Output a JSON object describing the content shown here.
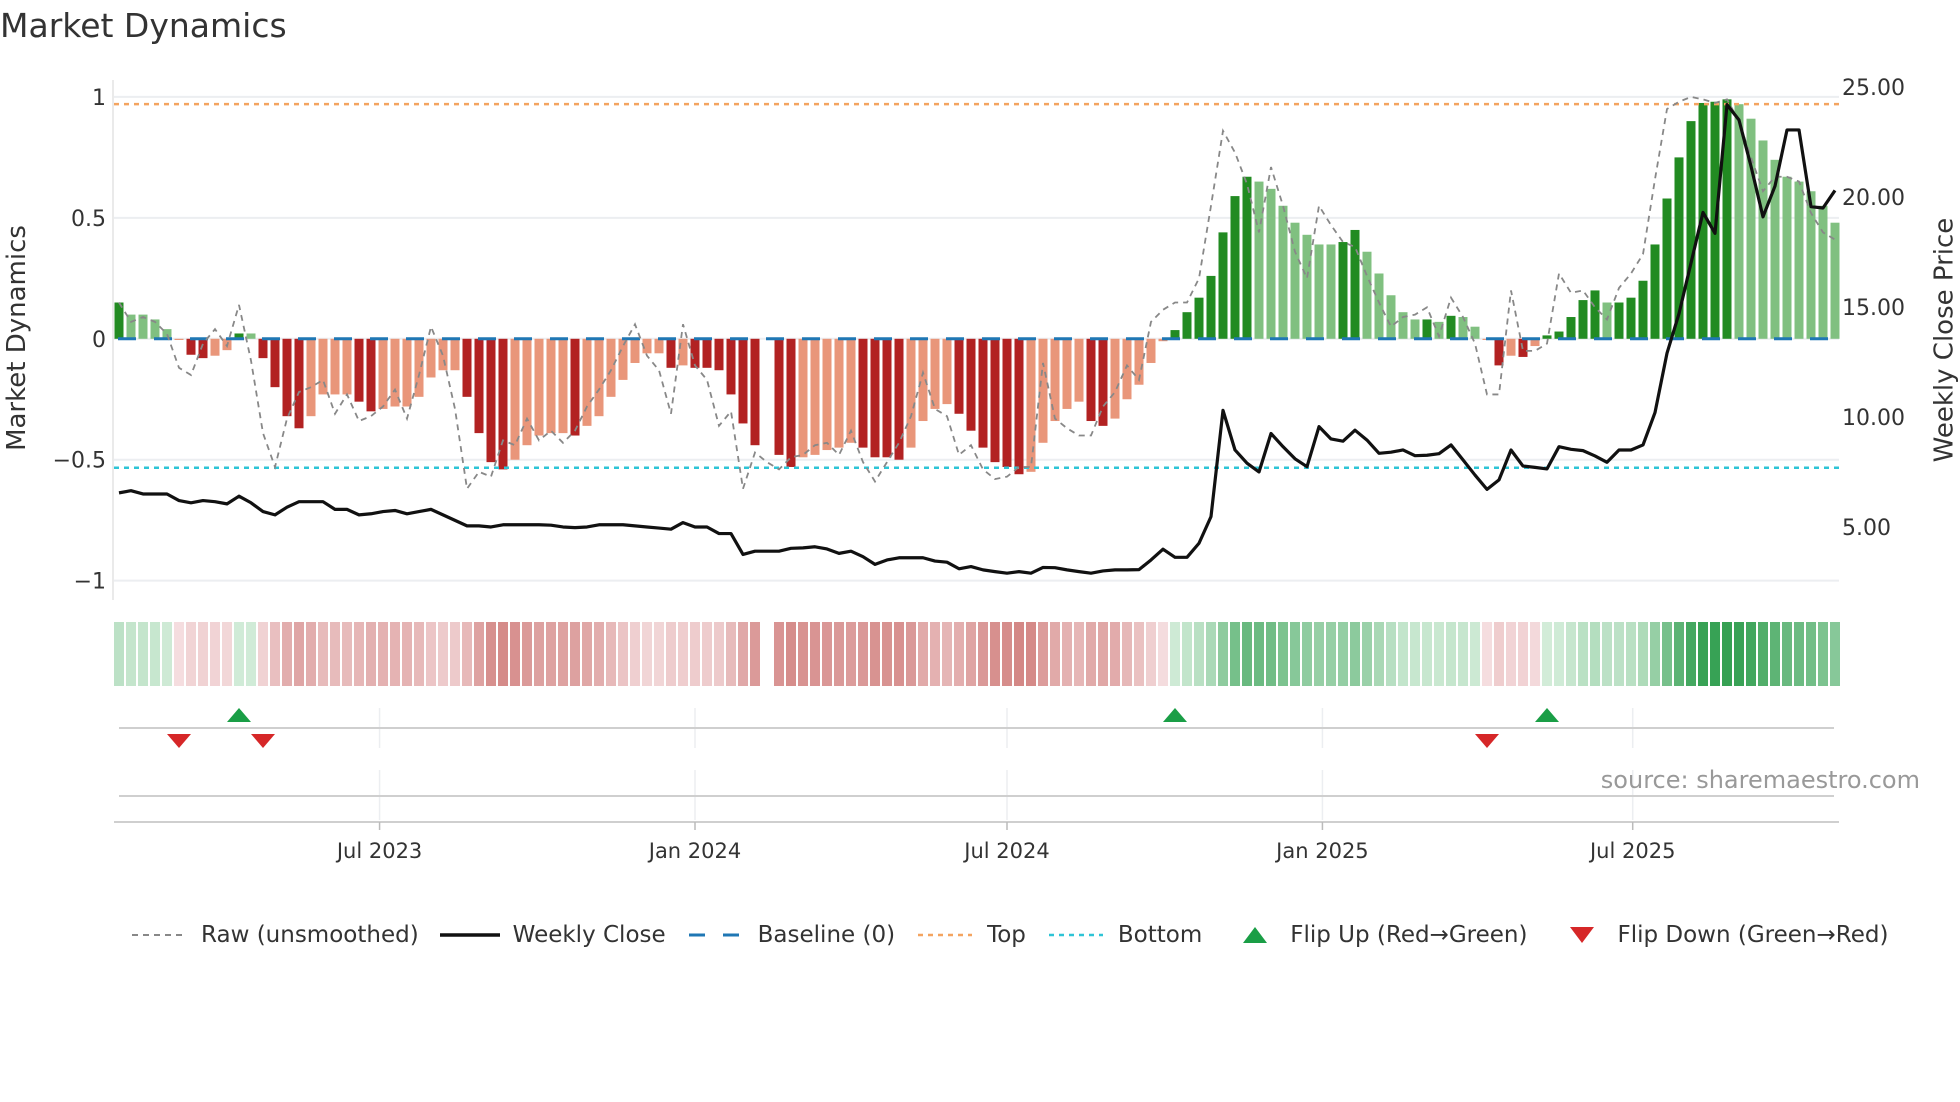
{
  "chart_data": {
    "type": "bar",
    "title": "Market Dynamics",
    "ylabel_left": "Market Dynamics",
    "ylabel_right": "Weekly Close Price",
    "ylim_left": [
      -1.08,
      1.07
    ],
    "ylim_right": [
      1.68,
      25.32
    ],
    "left_ticks": [
      {
        "v": 1,
        "label": "1"
      },
      {
        "v": 0.5,
        "label": "0.5"
      },
      {
        "v": 0,
        "label": "0"
      },
      {
        "v": -0.5,
        "label": "−0.5"
      },
      {
        "v": -1,
        "label": "−1"
      }
    ],
    "right_ticks": [
      {
        "v": 25,
        "label": "25.00"
      },
      {
        "v": 20,
        "label": "20.00"
      },
      {
        "v": 15,
        "label": "15.00"
      },
      {
        "v": 10,
        "label": "10.00"
      },
      {
        "v": 5,
        "label": "5.00"
      }
    ],
    "start_date": "2023-01-30",
    "frequency": "weekly",
    "x_ticks": [
      {
        "date": "2023-07-01",
        "label": "Jul 2023"
      },
      {
        "date": "2024-01-01",
        "label": "Jan 2024"
      },
      {
        "date": "2024-07-01",
        "label": "Jul 2024"
      },
      {
        "date": "2025-01-01",
        "label": "Jan 2025"
      },
      {
        "date": "2025-07-01",
        "label": "Jul 2025"
      }
    ],
    "grid": true,
    "top_level": 0.97,
    "bottom_level": -0.533,
    "baseline": 0,
    "momentum": [
      0.15,
      0.1,
      0.1,
      0.08,
      0.04,
      -0.005,
      -0.066,
      -0.08,
      -0.07,
      -0.047,
      0.022,
      0.022,
      -0.08,
      -0.2,
      -0.32,
      -0.37,
      -0.32,
      -0.23,
      -0.23,
      -0.23,
      -0.26,
      -0.3,
      -0.29,
      -0.28,
      -0.28,
      -0.24,
      -0.16,
      -0.13,
      -0.13,
      -0.24,
      -0.39,
      -0.51,
      -0.54,
      -0.5,
      -0.44,
      -0.4,
      -0.39,
      -0.39,
      -0.4,
      -0.36,
      -0.32,
      -0.24,
      -0.17,
      -0.1,
      -0.06,
      -0.06,
      -0.12,
      -0.11,
      -0.12,
      -0.12,
      -0.13,
      -0.23,
      -0.35,
      -0.44,
      null,
      -0.48,
      -0.53,
      -0.49,
      -0.48,
      -0.46,
      -0.45,
      -0.43,
      -0.45,
      -0.49,
      -0.49,
      -0.5,
      -0.45,
      -0.34,
      -0.29,
      -0.27,
      -0.31,
      -0.38,
      -0.45,
      -0.51,
      -0.53,
      -0.56,
      -0.55,
      -0.43,
      -0.34,
      -0.29,
      -0.26,
      -0.34,
      -0.36,
      -0.33,
      -0.25,
      -0.19,
      -0.1,
      -0.01,
      0.036,
      0.11,
      0.17,
      0.26,
      0.44,
      0.59,
      0.67,
      0.65,
      0.62,
      0.55,
      0.48,
      0.43,
      0.39,
      0.39,
      0.4,
      0.45,
      0.36,
      0.27,
      0.18,
      0.11,
      0.08,
      0.08,
      0.07,
      0.095,
      0.09,
      0.05,
      -0.005,
      -0.11,
      -0.07,
      -0.075,
      -0.03,
      0.014,
      0.03,
      0.09,
      0.16,
      0.2,
      0.15,
      0.15,
      0.17,
      0.24,
      0.39,
      0.58,
      0.75,
      0.9,
      0.975,
      0.98,
      0.99,
      0.97,
      0.91,
      0.82,
      0.74,
      0.67,
      0.65,
      0.61,
      0.55,
      0.48
    ],
    "strengthening": [
      1,
      0,
      0,
      0,
      0,
      0,
      1,
      1,
      0,
      0,
      1,
      0,
      1,
      1,
      1,
      1,
      0,
      0,
      0,
      0,
      1,
      1,
      0,
      0,
      0,
      0,
      0,
      0,
      0,
      1,
      1,
      1,
      1,
      0,
      0,
      0,
      0,
      0,
      1,
      0,
      0,
      0,
      0,
      0,
      0,
      0,
      1,
      0,
      1,
      1,
      1,
      1,
      1,
      1,
      0,
      1,
      1,
      0,
      0,
      0,
      0,
      0,
      1,
      1,
      1,
      1,
      0,
      0,
      0,
      0,
      1,
      1,
      1,
      1,
      1,
      1,
      0,
      0,
      0,
      0,
      0,
      1,
      1,
      0,
      0,
      0,
      0,
      0,
      1,
      1,
      1,
      1,
      1,
      1,
      1,
      0,
      0,
      0,
      0,
      0,
      0,
      0,
      1,
      1,
      0,
      0,
      0,
      0,
      0,
      1,
      0,
      1,
      0,
      0,
      0,
      1,
      0,
      1,
      0,
      1,
      1,
      1,
      1,
      1,
      0,
      1,
      1,
      1,
      1,
      1,
      1,
      1,
      1,
      1,
      1,
      0,
      0,
      0,
      0,
      0,
      0,
      0,
      0,
      0
    ],
    "raw": [
      0.15,
      0.07,
      0.09,
      0.07,
      0.02,
      -0.12,
      -0.15,
      -0.02,
      0.04,
      -0.03,
      0.14,
      -0.09,
      -0.39,
      -0.53,
      -0.33,
      -0.22,
      -0.2,
      -0.17,
      -0.31,
      -0.23,
      -0.34,
      -0.32,
      -0.28,
      -0.21,
      -0.33,
      -0.15,
      0.05,
      -0.07,
      -0.29,
      -0.62,
      -0.55,
      -0.57,
      -0.42,
      -0.44,
      -0.33,
      -0.42,
      -0.38,
      -0.43,
      -0.38,
      -0.28,
      -0.21,
      -0.13,
      -0.03,
      0.06,
      -0.07,
      -0.13,
      -0.31,
      0.06,
      -0.11,
      -0.17,
      -0.36,
      -0.3,
      -0.62,
      -0.47,
      -0.51,
      -0.54,
      -0.49,
      -0.48,
      -0.44,
      -0.43,
      -0.48,
      -0.38,
      -0.51,
      -0.59,
      -0.51,
      -0.43,
      -0.32,
      -0.14,
      -0.29,
      -0.32,
      -0.48,
      -0.44,
      -0.54,
      -0.58,
      -0.57,
      -0.53,
      -0.53,
      -0.1,
      -0.33,
      -0.37,
      -0.4,
      -0.4,
      -0.28,
      -0.22,
      -0.11,
      -0.17,
      0.07,
      0.12,
      0.15,
      0.15,
      0.25,
      0.55,
      0.86,
      0.77,
      0.64,
      0.44,
      0.71,
      0.55,
      0.36,
      0.25,
      0.55,
      0.47,
      0.4,
      0.38,
      0.26,
      0.15,
      0.05,
      0.09,
      0.1,
      0.13,
      0.01,
      0.17,
      0.09,
      -0.02,
      -0.23,
      -0.23,
      0.2,
      -0.05,
      -0.05,
      -0.02,
      0.27,
      0.19,
      0.2,
      0.13,
      0.08,
      0.21,
      0.27,
      0.35,
      0.66,
      0.95,
      0.98,
      1.0,
      0.99,
      0.975,
      0.99,
      0.9,
      0.75,
      0.61,
      0.67,
      0.67,
      0.65,
      0.52,
      0.44,
      0.41
    ],
    "weekly_close": [
      6.55,
      6.65,
      6.5,
      6.5,
      6.5,
      6.2,
      6.1,
      6.2,
      6.15,
      6.05,
      6.4,
      6.1,
      5.7,
      5.55,
      5.9,
      6.15,
      6.15,
      6.15,
      5.8,
      5.8,
      5.55,
      5.6,
      5.7,
      5.75,
      5.6,
      5.7,
      5.8,
      5.55,
      5.3,
      5.05,
      5.05,
      5.0,
      5.1,
      5.1,
      5.1,
      5.1,
      5.08,
      5.0,
      4.97,
      5.0,
      5.1,
      5.1,
      5.1,
      5.05,
      5.0,
      4.95,
      4.9,
      5.2,
      5.0,
      5.0,
      4.7,
      4.7,
      3.75,
      3.9,
      3.9,
      3.9,
      4.03,
      4.05,
      4.1,
      4.0,
      3.8,
      3.9,
      3.65,
      3.3,
      3.5,
      3.6,
      3.6,
      3.6,
      3.45,
      3.4,
      3.1,
      3.2,
      3.05,
      2.97,
      2.9,
      2.97,
      2.9,
      3.16,
      3.15,
      3.05,
      2.97,
      2.9,
      3.0,
      3.05,
      3.05,
      3.06,
      3.5,
      3.99,
      3.62,
      3.62,
      4.26,
      5.47,
      10.3,
      8.5,
      7.9,
      7.5,
      9.25,
      8.65,
      8.1,
      7.74,
      9.56,
      9.0,
      8.9,
      9.4,
      8.95,
      8.35,
      8.4,
      8.5,
      8.24,
      8.26,
      8.33,
      8.73,
      8.05,
      7.36,
      6.71,
      7.14,
      8.5,
      7.77,
      7.71,
      7.64,
      8.65,
      8.53,
      8.47,
      8.23,
      7.94,
      8.5,
      8.5,
      8.73,
      10.2,
      12.9,
      14.7,
      17.0,
      19.3,
      18.35,
      24.2,
      23.5,
      21.4,
      19.1,
      20.5,
      23.05,
      23.05,
      19.56,
      19.5,
      20.3
    ],
    "flip_up_weeks": [
      10,
      88,
      119
    ],
    "flip_down_weeks": [
      5,
      12,
      114
    ],
    "colors": {
      "green_strong": "#228b22",
      "green_weak": "#80c080",
      "red_strong": "#b22222",
      "red_weak": "#e9967a",
      "raw": "#888888",
      "close": "#111111",
      "baseline": "#1f77b4",
      "top": "#f4a460",
      "bottom": "#2ec4d6",
      "flip_up": "#1a9e46",
      "flip_down": "#d62728"
    },
    "legend": [
      {
        "key": "raw",
        "label": "Raw (unsmoothed)"
      },
      {
        "key": "close",
        "label": "Weekly Close"
      },
      {
        "key": "baseline",
        "label": "Baseline (0)"
      },
      {
        "key": "top",
        "label": "Top"
      },
      {
        "key": "bottom",
        "label": "Bottom"
      },
      {
        "key": "flip_up",
        "label": "Flip Up (Red→Green)"
      },
      {
        "key": "flip_down",
        "label": "Flip Down (Green→Red)"
      }
    ],
    "legend_placement": "bottom",
    "source": "source: sharemaestro.com"
  }
}
